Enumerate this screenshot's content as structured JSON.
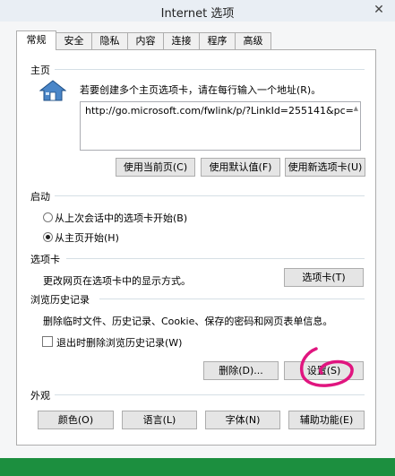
{
  "window": {
    "title": "Internet 选项",
    "close_glyph": "✕"
  },
  "tabs": [
    {
      "label": "常规",
      "active": true
    },
    {
      "label": "安全"
    },
    {
      "label": "隐私"
    },
    {
      "label": "内容"
    },
    {
      "label": "连接"
    },
    {
      "label": "程序"
    },
    {
      "label": "高级"
    }
  ],
  "homepage": {
    "group_label": "主页",
    "description": "若要创建多个主页选项卡，请在每行输入一个地址(R)。",
    "url": "http://go.microsoft.com/fwlink/p/?LinkId=255141&pc=",
    "icon": "house-icon",
    "buttons": {
      "use_current": "使用当前页(C)",
      "use_default": "使用默认值(F)",
      "use_new_tab": "使用新选项卡(U)"
    }
  },
  "startup": {
    "group_label": "启动",
    "option_last_session": "从上次会话中的选项卡开始(B)",
    "option_homepage": "从主页开始(H)",
    "selected": "option_homepage"
  },
  "tabs_section": {
    "group_label": "选项卡",
    "description": "更改网页在选项卡中的显示方式。",
    "button": "选项卡(T)"
  },
  "history": {
    "group_label": "浏览历史记录",
    "description": "删除临时文件、历史记录、Cookie、保存的密码和网页表单信息。",
    "checkbox_label": "退出时删除浏览历史记录(W)",
    "checkbox_checked": false,
    "delete_button": "删除(D)...",
    "settings_button": "设置(S)"
  },
  "appearance": {
    "group_label": "外观",
    "buttons": {
      "colors": "颜色(O)",
      "languages": "语言(L)",
      "fonts": "字体(N)",
      "accessibility": "辅助功能(E)"
    }
  },
  "colors": {
    "annotation": "#e0157f",
    "bottom_bar": "#1c8f3f"
  }
}
